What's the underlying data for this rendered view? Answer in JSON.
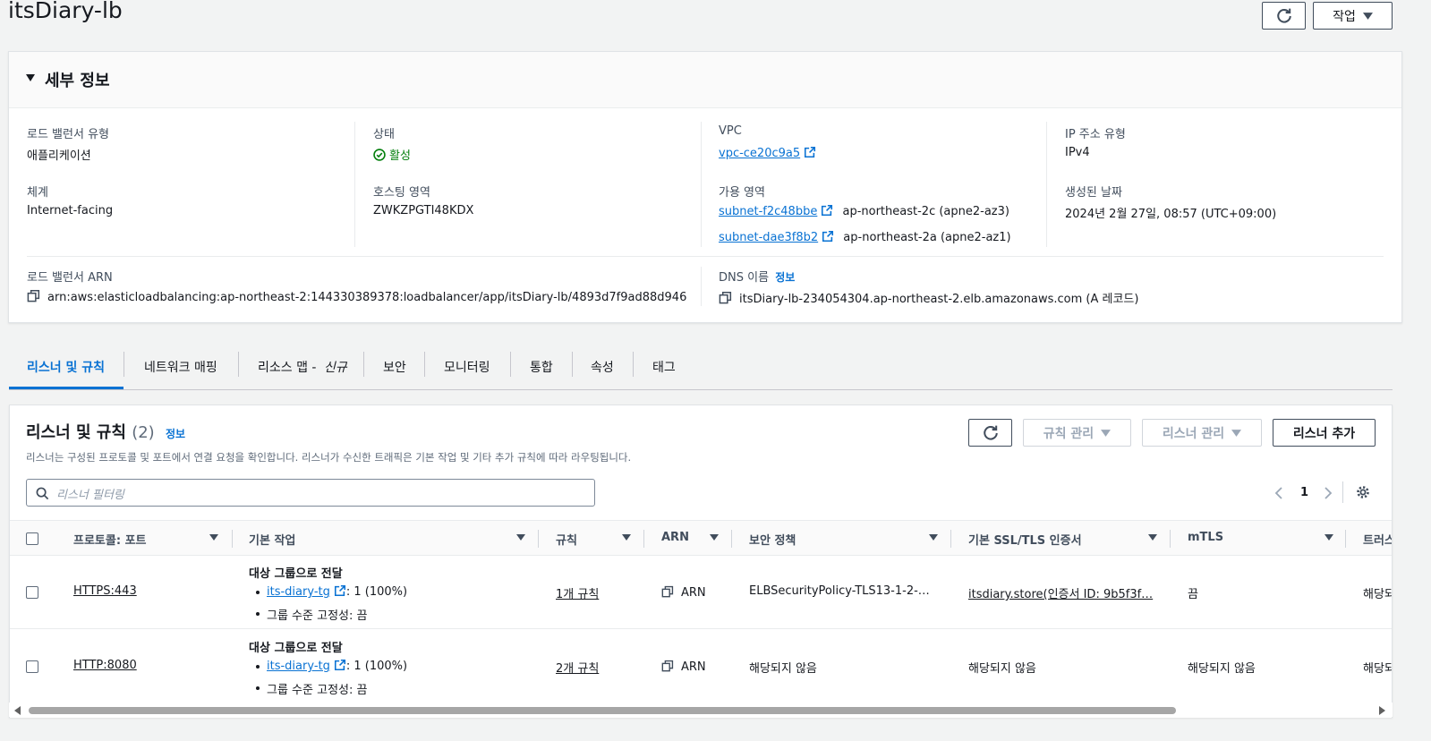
{
  "header": {
    "title": "itsDiary-lb",
    "actions_label": "작업"
  },
  "details": {
    "section_title": "세부 정보",
    "lb_type_label": "로드 밸런서 유형",
    "lb_type_value": "애플리케이션",
    "status_label": "상태",
    "status_value": "활성",
    "vpc_label": "VPC",
    "vpc_value": "vpc-ce20c9a5",
    "ip_type_label": "IP 주소 유형",
    "ip_type_value": "IPv4",
    "scheme_label": "체계",
    "scheme_value": "Internet-facing",
    "hosted_zone_label": "호스팅 영역",
    "hosted_zone_value": "ZWKZPGTI48KDX",
    "az_label": "가용 영역",
    "subnets": [
      {
        "id": "subnet-f2c48bbe",
        "zone": "ap-northeast-2c (apne2-az3)"
      },
      {
        "id": "subnet-dae3f8b2",
        "zone": "ap-northeast-2a (apne2-az1)"
      }
    ],
    "created_label": "생성된 날짜",
    "created_value": "2024년 2월 27일, 08:57 (UTC+09:00)",
    "arn_label": "로드 밸런서 ARN",
    "arn_value": "arn:aws:elasticloadbalancing:ap-northeast-2:144330389378:loadbalancer/app/itsDiary-lb/4893d7f9ad88d946",
    "dns_label": "DNS 이름",
    "dns_info": "정보",
    "dns_value": "itsDiary-lb-234054304.ap-northeast-2.elb.amazonaws.com (A 레코드)"
  },
  "tabs": [
    {
      "label": "리스너 및 규칙"
    },
    {
      "label": "네트워크 매핑"
    },
    {
      "label": "리소스 맵 - ",
      "suffix": "신규"
    },
    {
      "label": "보안"
    },
    {
      "label": "모니터링"
    },
    {
      "label": "통합"
    },
    {
      "label": "속성"
    },
    {
      "label": "태그"
    }
  ],
  "listeners": {
    "title": "리스너 및 규칙",
    "count": "(2)",
    "info": "정보",
    "description": "리스너는 구성된 프로토콜 및 포트에서 연결 요청을 확인합니다. 리스너가 수신한 트래픽은 기본 작업 및 기타 추가 규칙에 따라 라우팅됩니다.",
    "manage_rules": "규칙 관리",
    "manage_listener": "리스너 관리",
    "add_listener": "리스너 추가",
    "filter_placeholder": "리스너 필터링",
    "page": "1",
    "columns": [
      "프로토콜: 포트",
      "기본 작업",
      "규칙",
      "ARN",
      "보안 정책",
      "기본 SSL/TLS 인증서",
      "mTLS",
      "트러스"
    ],
    "rows": [
      {
        "protocol_port": "HTTPS:443",
        "action_title": "대상 그룹으로 전달",
        "target_group": "its-diary-tg",
        "weight": ": 1 (100%)",
        "stickiness": "그룹 수준 고정성: 끔",
        "rules": "1개 규칙",
        "arn": "ARN",
        "security_policy": "ELBSecurityPolicy-TLS13-1-2-…",
        "certificate": "itsdiary.store(인증서 ID: 9b5f3f…",
        "mtls": "끔",
        "trust": "해당되"
      },
      {
        "protocol_port": "HTTP:8080",
        "action_title": "대상 그룹으로 전달",
        "target_group": "its-diary-tg",
        "weight": ": 1 (100%)",
        "stickiness": "그룹 수준 고정성: 끔",
        "rules": "2개 규칙",
        "arn": "ARN",
        "security_policy": "해당되지 않음",
        "certificate": "해당되지 않음",
        "mtls": "해당되지 않음",
        "trust": "해당되"
      }
    ]
  },
  "colors": {
    "link": "#0972d3",
    "success": "#037f0c",
    "text": "#16191f"
  }
}
